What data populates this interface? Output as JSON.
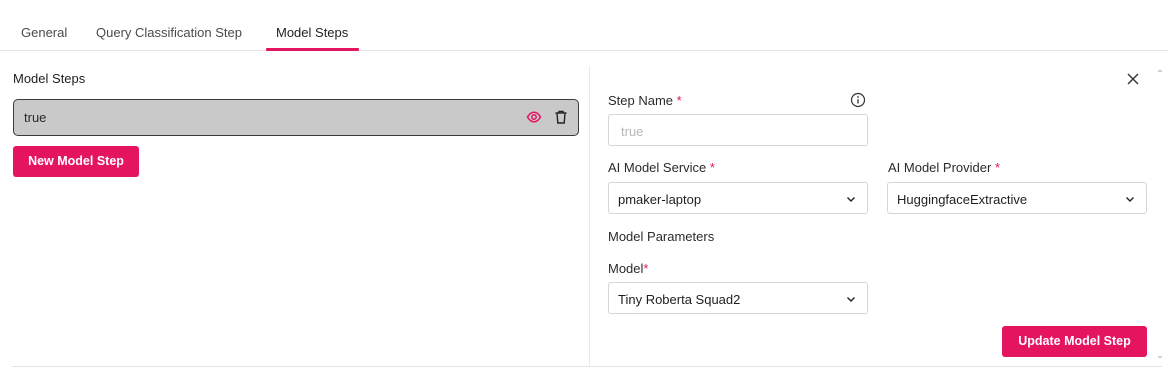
{
  "tabs": [
    {
      "label": "General"
    },
    {
      "label": "Query Classification Step"
    },
    {
      "label": "Model Steps"
    }
  ],
  "left_panel": {
    "title": "Model Steps",
    "steps": [
      {
        "name": "true"
      }
    ],
    "new_button_label": "New Model Step"
  },
  "form": {
    "step_name_label": "Step Name",
    "step_name_placeholder": "true",
    "service_label": "AI Model Service",
    "service_value": "pmaker-laptop",
    "provider_label": "AI Model Provider",
    "provider_value": "HuggingfaceExtractive",
    "params_heading": "Model Parameters",
    "model_label": "Model",
    "model_value": "Tiny Roberta Squad2",
    "required_marker": "*",
    "update_button_label": "Update Model Step"
  },
  "icons": {
    "view": "eye-icon",
    "delete": "trash-icon",
    "info": "info-icon",
    "close": "close-icon",
    "dropdown": "chevron-down-icon"
  },
  "colors": {
    "accent": "#e5145e",
    "step_row_bg": "#c9c9c9"
  }
}
